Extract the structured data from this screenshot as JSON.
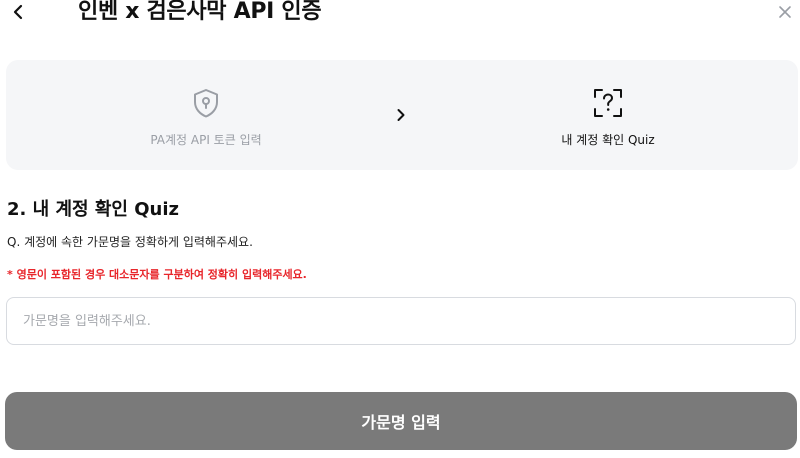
{
  "header": {
    "title": "인벤 x 검은사막 API 인증",
    "back_icon": "chevron-left-icon",
    "close_icon": "close-icon"
  },
  "steps": [
    {
      "label": "PA계정 API 토큰 입력",
      "icon": "shield-keyhole-icon",
      "active": false
    },
    {
      "label": "내 계정 확인 Quiz",
      "icon": "scan-question-icon",
      "active": true
    }
  ],
  "step_arrow_icon": "chevron-right-icon",
  "section": {
    "title": "2. 내 계정 확인 Quiz",
    "question": "Q. 계정에 속한 가문명을 정확하게 입력해주세요.",
    "warning": "* 영문이 포함된 경우 대소문자를 구분하여 정확히 입력해주세요."
  },
  "input": {
    "value": "",
    "placeholder": "가문명을 입력해주세요."
  },
  "submit": {
    "label": "가문명 입력"
  },
  "colors": {
    "card_bg": "#f5f6f8",
    "warning": "#e8262b",
    "button_bg": "#7a7a7a",
    "muted_text": "#9a9ea5"
  }
}
